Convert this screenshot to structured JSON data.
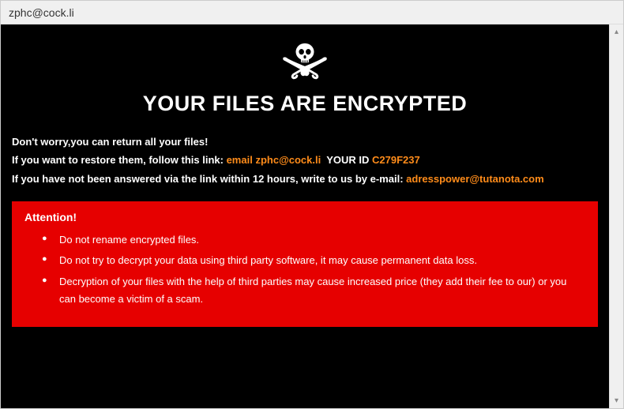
{
  "window": {
    "title": "zphc@cock.li"
  },
  "content": {
    "heading": "YOUR FILES ARE ENCRYPTED",
    "line1": "Don't worry,you can return all your files!",
    "line2_pre": "If you want to restore them, follow this link: ",
    "line2_email_label": "email",
    "line2_email": "zphc@cock.li",
    "line2_yourid_label": "YOUR ID",
    "line2_yourid": "C279F237",
    "line3_pre": "If you have not been answered via the link within 12 hours, write to us by e-mail: ",
    "line3_email": "adresspower@tutanota.com"
  },
  "attention": {
    "title": "Attention!",
    "items": [
      "Do not rename encrypted files.",
      "Do not try to decrypt your data using third party software, it may cause permanent data loss.",
      "Decryption of your files with the help of third parties may cause increased price (they add their fee to our) or you can become a victim of a scam."
    ]
  },
  "scrollbar": {
    "up": "▴",
    "down": "▾"
  }
}
